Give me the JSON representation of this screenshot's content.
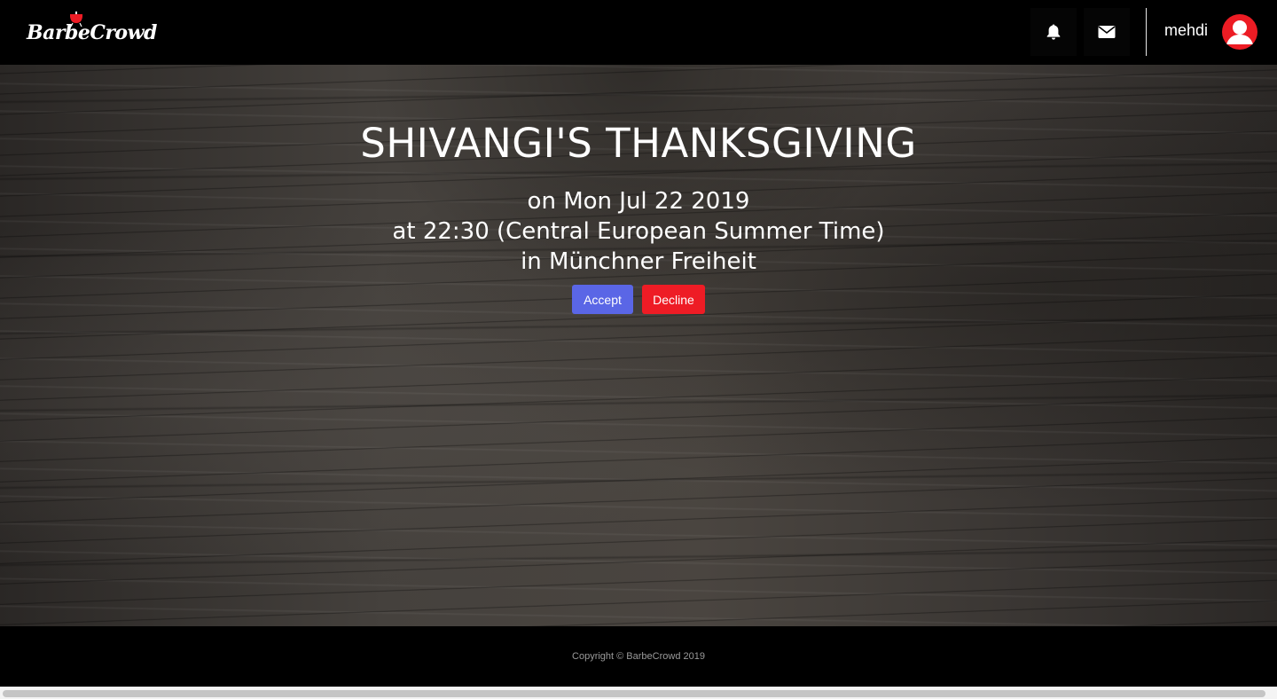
{
  "navbar": {
    "brand": "BarbeCrowd",
    "notifications_icon": "bell-icon",
    "messages_icon": "envelope-icon",
    "username": "mehdi",
    "avatar_icon": "user-avatar-icon"
  },
  "event": {
    "title": "SHIVANGI'S THANKSGIVING",
    "date_line": "on Mon Jul 22 2019",
    "time_line": "at 22:30 (Central European Summer Time)",
    "place_line": "in Münchner Freiheit"
  },
  "actions": {
    "accept_label": "Accept",
    "decline_label": "Decline"
  },
  "footer": {
    "copyright": "Copyright © BarbeCrowd 2019"
  },
  "colors": {
    "navbar_bg": "#000000",
    "accept": "#5a66e6",
    "decline": "#ee1c25",
    "avatar": "#ed1c24"
  }
}
